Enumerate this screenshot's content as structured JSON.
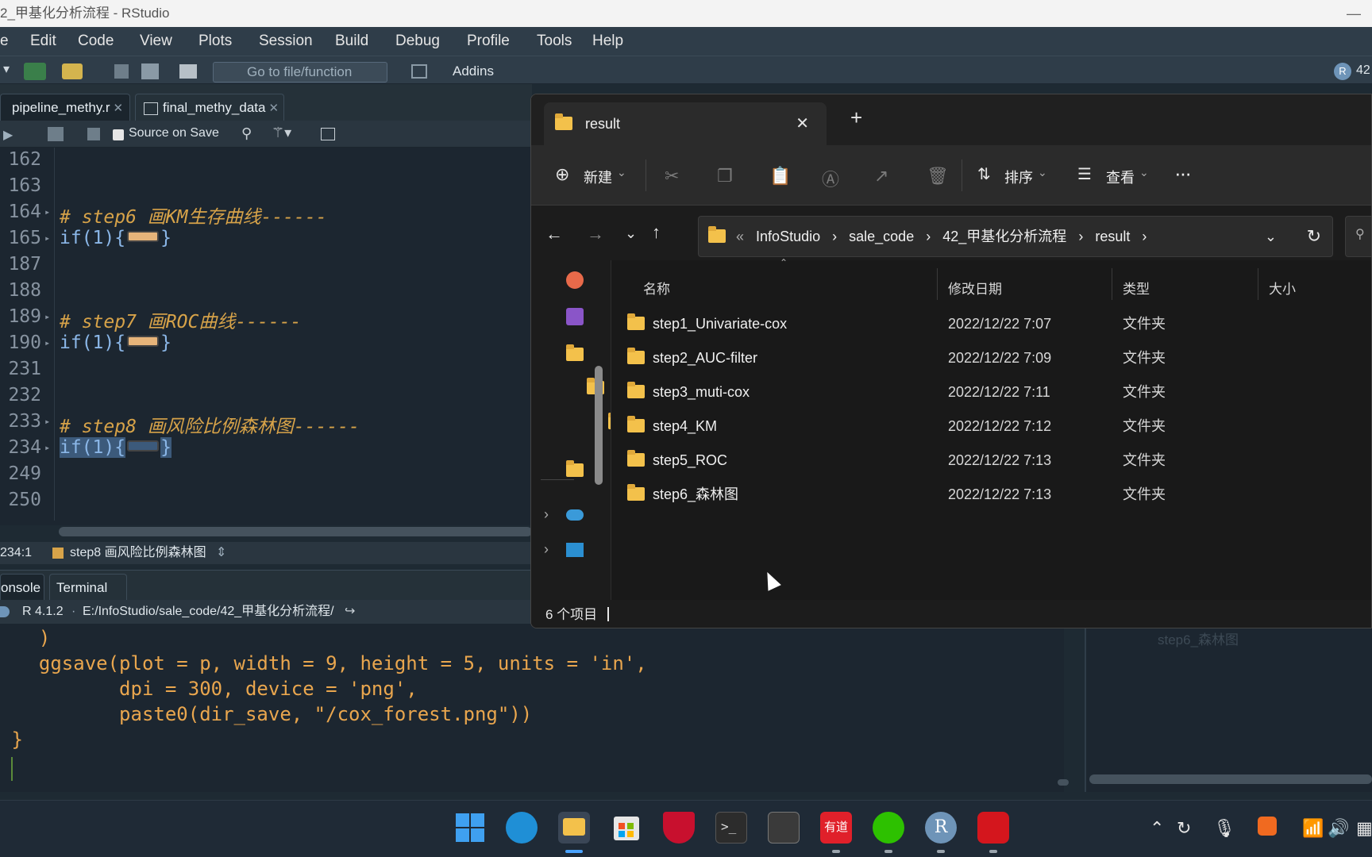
{
  "window": {
    "title": "2_甲基化分析流程 - RStudio",
    "minimize": "—"
  },
  "menu": [
    "e",
    "Edit",
    "Code",
    "View",
    "Plots",
    "Session",
    "Build",
    "Debug",
    "Profile",
    "Tools",
    "Help"
  ],
  "toolbar": {
    "goto_placeholder": "Go to file/function",
    "addins": "Addins",
    "project_badge": "R",
    "project_num": "42"
  },
  "editor_tabs": [
    {
      "label": "pipeline_methy.r"
    },
    {
      "label": "final_methy_data"
    }
  ],
  "editor_toolbar": {
    "source_on_save": "Source on Save"
  },
  "editor_lines": [
    {
      "num": "162",
      "text": ""
    },
    {
      "num": "163",
      "text": ""
    },
    {
      "num": "164",
      "text": "# step6 画KM生存曲线------",
      "type": "comment",
      "fold": true
    },
    {
      "num": "165",
      "text": "if(1){",
      "type": "code",
      "fold": true,
      "collapsed": true
    },
    {
      "num": "187",
      "text": ""
    },
    {
      "num": "188",
      "text": ""
    },
    {
      "num": "189",
      "text": "# step7 画ROC曲线------",
      "type": "comment",
      "fold": true
    },
    {
      "num": "190",
      "text": "if(1){",
      "type": "code",
      "fold": true,
      "collapsed": true
    },
    {
      "num": "231",
      "text": ""
    },
    {
      "num": "232",
      "text": ""
    },
    {
      "num": "233",
      "text": "# step8 画风险比例森林图------",
      "type": "comment",
      "fold": true
    },
    {
      "num": "234",
      "text": "if(1){",
      "type": "code",
      "fold": true,
      "collapsed": true,
      "selected": true
    },
    {
      "num": "249",
      "text": ""
    },
    {
      "num": "250",
      "text": ""
    }
  ],
  "close_brace": "}",
  "statusbar": {
    "position": "234:1",
    "section": "step8 画风险比例森林图"
  },
  "console_tabs": [
    {
      "label": "onsole"
    },
    {
      "label": "Terminal"
    }
  ],
  "console_path": {
    "version": "R 4.1.2",
    "sep": "·",
    "path": "E:/InfoStudio/sale_code/42_甲基化分析流程/"
  },
  "console_lines": [
    "  )",
    "  ggsave(plot = p, width = 9, height = 5, units = 'in',",
    "         dpi = 300, device = 'png',",
    "         paste0(dir_save, \"/cox_forest.png\"))",
    " }"
  ],
  "right_pane_ghost": "step6_森林图",
  "explorer": {
    "tab_title": "result",
    "cmd": {
      "new": "新建",
      "sort": "排序",
      "view": "查看",
      "more": "···"
    },
    "breadcrumb": [
      "InfoStudio",
      "sale_code",
      "42_甲基化分析流程",
      "result"
    ],
    "breadcrumb_prefix": "«",
    "columns": {
      "name": "名称",
      "date": "修改日期",
      "type": "类型",
      "size": "大小"
    },
    "rows": [
      {
        "name": "step1_Univariate-cox",
        "date": "2022/12/22 7:07",
        "type": "文件夹"
      },
      {
        "name": "step2_AUC-filter",
        "date": "2022/12/22 7:09",
        "type": "文件夹"
      },
      {
        "name": "step3_muti-cox",
        "date": "2022/12/22 7:11",
        "type": "文件夹"
      },
      {
        "name": "step4_KM",
        "date": "2022/12/22 7:12",
        "type": "文件夹"
      },
      {
        "name": "step5_ROC",
        "date": "2022/12/22 7:13",
        "type": "文件夹"
      },
      {
        "name": "step6_森林图",
        "date": "2022/12/22 7:13",
        "type": "文件夹"
      }
    ],
    "status": "6 个项目"
  },
  "taskbar": {
    "apps": [
      "start-icon",
      "edge-icon",
      "file-explorer-icon",
      "store-icon",
      "mcafee-icon",
      "terminal-icon",
      "cmd-icon",
      "youdao-icon",
      "wechat-icon",
      "r-icon",
      "wps-icon"
    ],
    "youdao_label": "有道"
  },
  "colors": {
    "editor_bg": "#1c2630",
    "comment": "#d7a349",
    "keyword": "#8bb7e8",
    "folder": "#f3c14b",
    "explorer_bg": "#191919"
  }
}
